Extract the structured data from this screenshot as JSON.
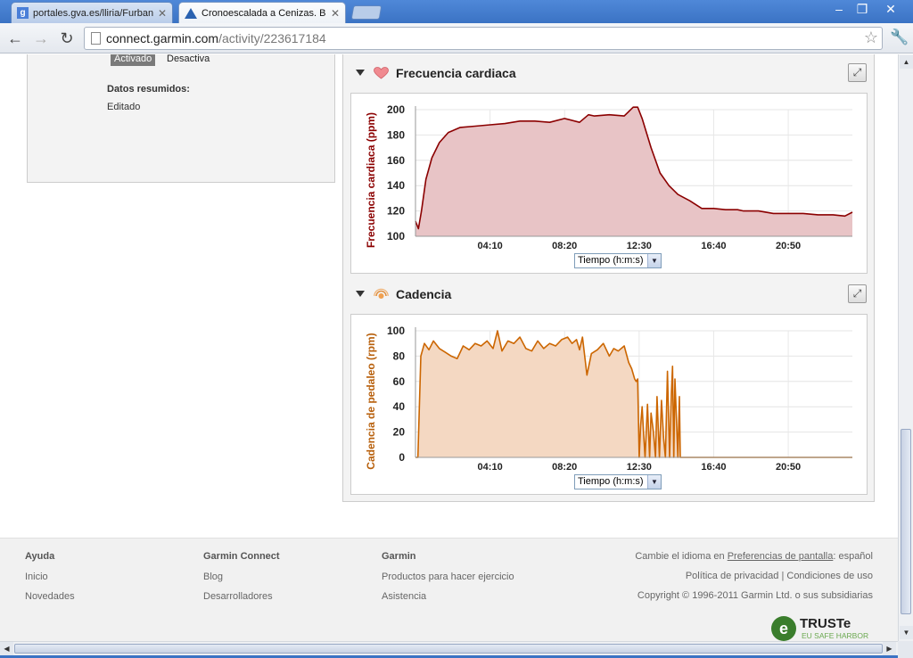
{
  "browser": {
    "tabs": [
      {
        "title": "portales.gva.es/lliria/Furbanis",
        "active": false
      },
      {
        "title": "Cronoescalada a Cenizas. Bu",
        "active": true
      }
    ],
    "url_host": "connect.garmin.com",
    "url_path": "/activity/223617184"
  },
  "left_panel": {
    "activated_label": "Activado",
    "deactivated_label": "Desactiva",
    "summary_heading": "Datos resumidos:",
    "summary_value": "Editado"
  },
  "sections": {
    "heart_rate": {
      "title": "Frecuencia cardiaca",
      "icon": "heart-icon"
    },
    "cadence": {
      "title": "Cadencia",
      "icon": "cadence-icon"
    }
  },
  "x_selector_label": "Tiempo (h:m:s)",
  "colors": {
    "hr_line": "#8b0000",
    "hr_fill": "#e8c4c6",
    "cad_line": "#cc6600",
    "cad_fill": "#f4d8c2",
    "hr_axis": "#8b0000",
    "cad_axis": "#b8600c"
  },
  "chart_data": [
    {
      "type": "area",
      "ylabel": "Frecuencia cardiaca (ppm)",
      "ylim": [
        100,
        200
      ],
      "yticks": [
        100,
        120,
        140,
        160,
        180,
        200
      ],
      "xticks": [
        "04:10",
        "08:20",
        "12:30",
        "16:40",
        "20:50"
      ],
      "xtick_seconds": [
        250,
        500,
        750,
        1000,
        1250
      ],
      "xlim_seconds": [
        0,
        1465
      ],
      "grid": true,
      "x": [
        0,
        10,
        20,
        35,
        55,
        80,
        110,
        150,
        200,
        250,
        300,
        350,
        400,
        450,
        500,
        550,
        580,
        600,
        650,
        700,
        730,
        745,
        760,
        790,
        820,
        850,
        880,
        920,
        960,
        1000,
        1040,
        1080,
        1100,
        1150,
        1200,
        1250,
        1300,
        1350,
        1400,
        1440,
        1465
      ],
      "values": [
        112,
        106,
        120,
        145,
        162,
        174,
        182,
        186,
        187,
        188,
        189,
        191,
        191,
        190,
        193,
        190,
        196,
        195,
        196,
        195,
        202,
        202,
        193,
        170,
        150,
        140,
        133,
        128,
        122,
        122,
        121,
        121,
        120,
        120,
        118,
        118,
        118,
        117,
        117,
        116,
        119
      ]
    },
    {
      "type": "area",
      "ylabel": "Cadencia de pedaleo (rpm)",
      "ylim": [
        0,
        100
      ],
      "yticks": [
        0,
        20,
        40,
        60,
        80,
        100
      ],
      "xticks": [
        "04:10",
        "08:20",
        "12:30",
        "16:40",
        "20:50"
      ],
      "xtick_seconds": [
        250,
        500,
        750,
        1000,
        1250
      ],
      "xlim_seconds": [
        0,
        1465
      ],
      "grid": true,
      "x": [
        0,
        8,
        18,
        30,
        45,
        60,
        80,
        100,
        120,
        140,
        160,
        180,
        200,
        220,
        240,
        260,
        275,
        290,
        310,
        330,
        350,
        370,
        390,
        410,
        430,
        450,
        470,
        490,
        510,
        525,
        540,
        550,
        560,
        575,
        590,
        610,
        630,
        650,
        665,
        680,
        700,
        715,
        725,
        735,
        740,
        745,
        750,
        755,
        760,
        765,
        770,
        778,
        785,
        790,
        798,
        805,
        810,
        818,
        825,
        832,
        838,
        845,
        852,
        858,
        862,
        866,
        870,
        875,
        880,
        885,
        888,
        1465
      ],
      "values": [
        0,
        0,
        80,
        90,
        85,
        92,
        86,
        83,
        80,
        78,
        88,
        85,
        90,
        88,
        92,
        86,
        100,
        84,
        92,
        90,
        95,
        86,
        84,
        92,
        86,
        90,
        88,
        93,
        95,
        90,
        93,
        85,
        95,
        65,
        82,
        85,
        90,
        80,
        86,
        84,
        88,
        75,
        70,
        62,
        60,
        62,
        0,
        25,
        40,
        18,
        0,
        42,
        0,
        35,
        20,
        0,
        48,
        0,
        45,
        15,
        0,
        68,
        0,
        50,
        72,
        0,
        62,
        30,
        0,
        48,
        0,
        0
      ]
    }
  ],
  "footer": {
    "col1": {
      "head": "Ayuda",
      "items": [
        "Inicio",
        "Novedades"
      ]
    },
    "col2": {
      "head": "Garmin Connect",
      "items": [
        "Blog",
        "Desarrolladores"
      ]
    },
    "col3": {
      "head": "Garmin",
      "items": [
        "Productos para hacer ejercicio",
        "Asistencia"
      ]
    },
    "lang_prefix": "Cambie el idioma en ",
    "lang_link": "Preferencias de pantalla",
    "lang_value": ": español",
    "privacy": "Política de privacidad",
    "sep": " | ",
    "terms": "Condiciones de uso",
    "copyright": "Copyright © 1996-2011 Garmin Ltd. o sus subsidiarias",
    "truste_name": "TRUSTe",
    "truste_sub": "EU SAFE HARBOR"
  }
}
